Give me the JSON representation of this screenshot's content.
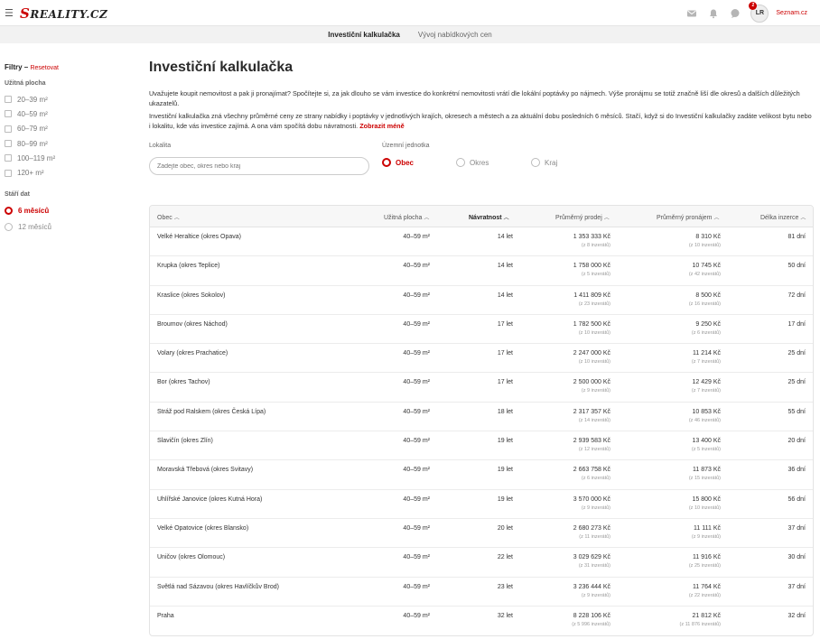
{
  "header": {
    "logo": "REALITY.CZ",
    "logo_s": "S",
    "avatar_initials": "LR",
    "avatar_badge": "2",
    "seznam_link": "Seznam.cz"
  },
  "subnav": {
    "tabs": [
      {
        "label": "Investiční kalkulačka",
        "active": true
      },
      {
        "label": "Vývoj nabídkových cen",
        "active": false
      }
    ]
  },
  "sidebar": {
    "filters_title": "Filtry",
    "filters_dash": " – ",
    "reset_label": "Resetovat",
    "area_heading": "Užitná plocha",
    "area_options": [
      "20–39 m²",
      "40–59 m²",
      "60–79 m²",
      "80–99 m²",
      "100–119 m²",
      "120+ m²"
    ],
    "age_heading": "Stáří dat",
    "age_options": [
      {
        "label": "6 měsíců",
        "active": true
      },
      {
        "label": "12 měsíců",
        "active": false
      }
    ]
  },
  "main": {
    "title": "Investiční kalkulačka",
    "intro_p1": "Uvažujete koupit nemovitost a pak ji pronajímat? Spočítejte si, za jak dlouho se vám investice do konkrétní nemovitosti vrátí dle lokální poptávky po nájmech. Výše pronájmu se totiž značně liší dle okresů a dalších důležitých ukazatelů.",
    "intro_p2": "Investiční kalkulačka zná všechny průměrné ceny ze strany nabídky i poptávky v jednotlivých krajích, okresech a městech a za aktuální dobu posledních 6 měsíců. Stačí, když si do Investiční kalkulačky zadáte velikost bytu nebo i lokalitu, kde vás investice zajímá. A ona vám spočítá dobu návratnosti. ",
    "show_less": "Zobrazit méně",
    "locality_label": "Lokalita",
    "locality_placeholder": "Zadejte obec, okres nebo kraj",
    "unit_label": "Územní jednotka",
    "unit_options": [
      {
        "label": "Obec",
        "active": true
      },
      {
        "label": "Okres",
        "active": false
      },
      {
        "label": "Kraj",
        "active": false
      }
    ]
  },
  "table": {
    "columns": {
      "obec": "Obec",
      "plocha": "Užitná plocha",
      "navratnost": "Návratnost",
      "prodej": "Průměrný prodej",
      "pronajem": "Průměrný pronájem",
      "delka": "Délka inzerce"
    },
    "rows": [
      {
        "obec": "Velké Heraltice (okres Opava)",
        "plocha": "40–59 m²",
        "navratnost": "14 let",
        "prodej": "1 353 333 Kč",
        "prodej_sub": "(z 8 inzerátů)",
        "pronajem": "8 310 Kč",
        "pronajem_sub": "(z 10 inzerátů)",
        "delka": "81 dní"
      },
      {
        "obec": "Krupka (okres Teplice)",
        "plocha": "40–59 m²",
        "navratnost": "14 let",
        "prodej": "1 758 000 Kč",
        "prodej_sub": "(z 5 inzerátů)",
        "pronajem": "10 745 Kč",
        "pronajem_sub": "(z 42 inzerátů)",
        "delka": "50 dní"
      },
      {
        "obec": "Kraslice (okres Sokolov)",
        "plocha": "40–59 m²",
        "navratnost": "14 let",
        "prodej": "1 411 809 Kč",
        "prodej_sub": "(z 23 inzerátů)",
        "pronajem": "8 500 Kč",
        "pronajem_sub": "(z 16 inzerátů)",
        "delka": "72 dní"
      },
      {
        "obec": "Broumov (okres Náchod)",
        "plocha": "40–59 m²",
        "navratnost": "17 let",
        "prodej": "1 782 500 Kč",
        "prodej_sub": "(z 10 inzerátů)",
        "pronajem": "9 250 Kč",
        "pronajem_sub": "(z 6 inzerátů)",
        "delka": "17 dní"
      },
      {
        "obec": "Volary (okres Prachatice)",
        "plocha": "40–59 m²",
        "navratnost": "17 let",
        "prodej": "2 247 000 Kč",
        "prodej_sub": "(z 10 inzerátů)",
        "pronajem": "11 214 Kč",
        "pronajem_sub": "(z 7 inzerátů)",
        "delka": "25 dní"
      },
      {
        "obec": "Bor (okres Tachov)",
        "plocha": "40–59 m²",
        "navratnost": "17 let",
        "prodej": "2 500 000 Kč",
        "prodej_sub": "(z 9 inzerátů)",
        "pronajem": "12 429 Kč",
        "pronajem_sub": "(z 7 inzerátů)",
        "delka": "25 dní"
      },
      {
        "obec": "Stráž pod Ralskem (okres Česká Lípa)",
        "plocha": "40–59 m²",
        "navratnost": "18 let",
        "prodej": "2 317 357 Kč",
        "prodej_sub": "(z 14 inzerátů)",
        "pronajem": "10 853 Kč",
        "pronajem_sub": "(z 46 inzerátů)",
        "delka": "55 dní"
      },
      {
        "obec": "Slavičín (okres Zlín)",
        "plocha": "40–59 m²",
        "navratnost": "19 let",
        "prodej": "2 939 583 Kč",
        "prodej_sub": "(z 12 inzerátů)",
        "pronajem": "13 400 Kč",
        "pronajem_sub": "(z 5 inzerátů)",
        "delka": "20 dní"
      },
      {
        "obec": "Moravská Třebová (okres Svitavy)",
        "plocha": "40–59 m²",
        "navratnost": "19 let",
        "prodej": "2 663 758 Kč",
        "prodej_sub": "(z 6 inzerátů)",
        "pronajem": "11 873 Kč",
        "pronajem_sub": "(z 15 inzerátů)",
        "delka": "36 dní"
      },
      {
        "obec": "Uhlířské Janovice (okres Kutná Hora)",
        "plocha": "40–59 m²",
        "navratnost": "19 let",
        "prodej": "3 570 000 Kč",
        "prodej_sub": "(z 9 inzerátů)",
        "pronajem": "15 800 Kč",
        "pronajem_sub": "(z 10 inzerátů)",
        "delka": "56 dní"
      },
      {
        "obec": "Velké Opatovice (okres Blansko)",
        "plocha": "40–59 m²",
        "navratnost": "20 let",
        "prodej": "2 680 273 Kč",
        "prodej_sub": "(z 11 inzerátů)",
        "pronajem": "11 111 Kč",
        "pronajem_sub": "(z 9 inzerátů)",
        "delka": "37 dní"
      },
      {
        "obec": "Uničov (okres Olomouc)",
        "plocha": "40–59 m²",
        "navratnost": "22 let",
        "prodej": "3 029 629 Kč",
        "prodej_sub": "(z 31 inzerátů)",
        "pronajem": "11 916 Kč",
        "pronajem_sub": "(z 25 inzerátů)",
        "delka": "30 dní"
      },
      {
        "obec": "Světlá nad Sázavou (okres Havlíčkův Brod)",
        "plocha": "40–59 m²",
        "navratnost": "23 let",
        "prodej": "3 236 444 Kč",
        "prodej_sub": "(z 9 inzerátů)",
        "pronajem": "11 764 Kč",
        "pronajem_sub": "(z 22 inzerátů)",
        "delka": "37 dní"
      },
      {
        "obec": "Praha",
        "plocha": "40–59 m²",
        "navratnost": "32 let",
        "prodej": "8 228 106 Kč",
        "prodej_sub": "(z 5 996 inzerátů)",
        "pronajem": "21 812 Kč",
        "pronajem_sub": "(z 11 876 inzerátů)",
        "delka": "32 dní"
      }
    ]
  },
  "colors": {
    "accent": "#cc0000",
    "text": "#2b2b2b",
    "muted": "#999999"
  }
}
